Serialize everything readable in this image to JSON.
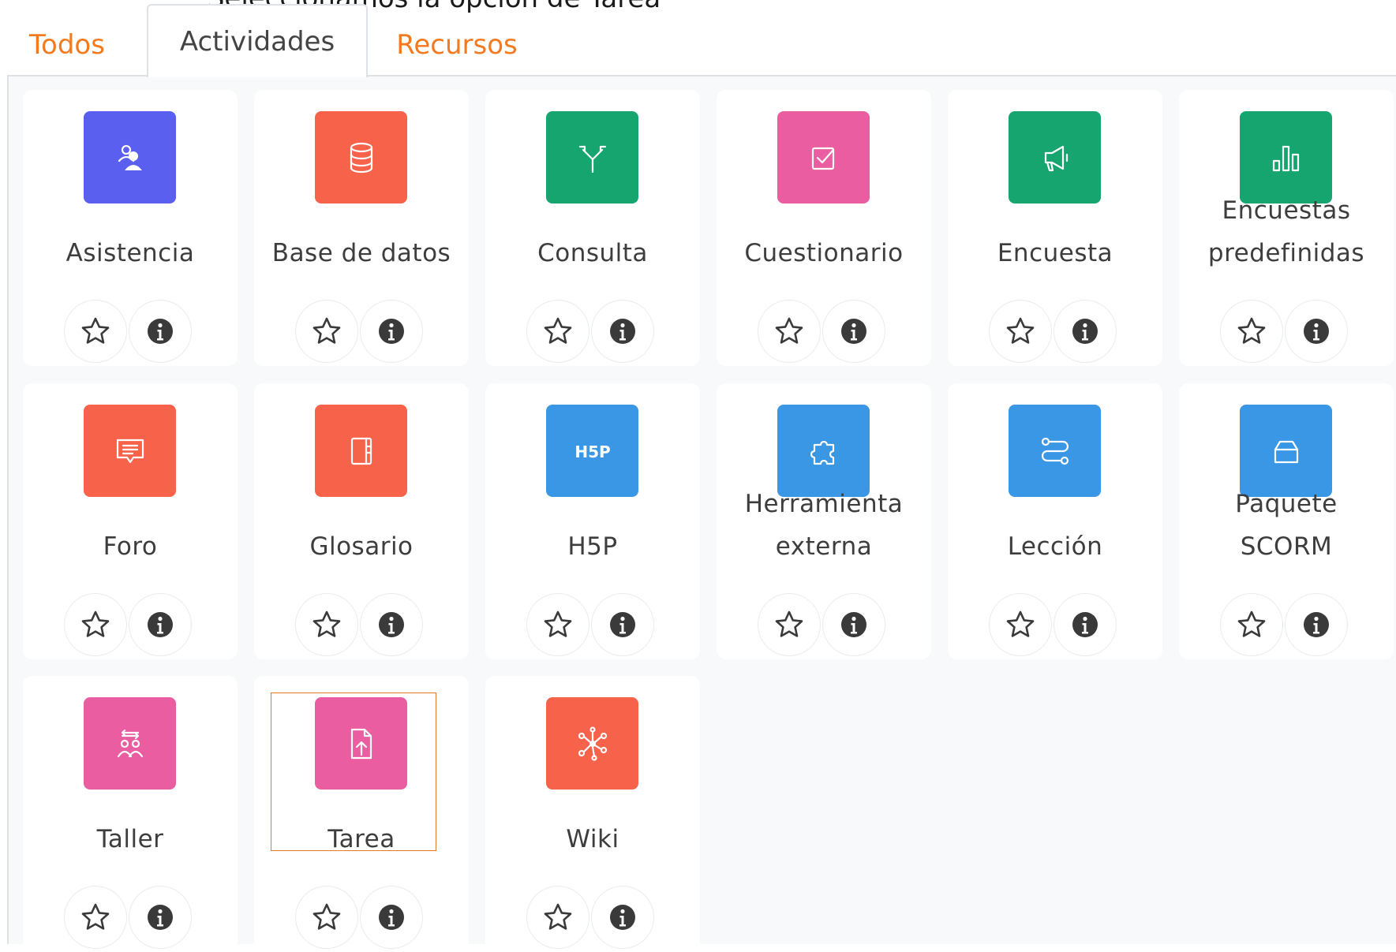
{
  "caption": "Seleccionamos la opción de Tarea",
  "tabs": [
    {
      "label": "Todos",
      "active": false
    },
    {
      "label": "Actividades",
      "active": true
    },
    {
      "label": "Recursos",
      "active": false
    }
  ],
  "activities": [
    {
      "label": "Asistencia",
      "icon": "attendance-icon",
      "color": "#5b5fef"
    },
    {
      "label": "Base de datos",
      "icon": "database-icon",
      "color": "#f7624b"
    },
    {
      "label": "Consulta",
      "icon": "choice-icon",
      "color": "#16a56e"
    },
    {
      "label": "Cuestionario",
      "icon": "quiz-icon",
      "color": "#ea5da0"
    },
    {
      "label": "Encuesta",
      "icon": "megaphone-icon",
      "color": "#16a56e"
    },
    {
      "label": "Encuestas predefinidas",
      "icon": "bar-chart-icon",
      "color": "#16a56e"
    },
    {
      "label": "Foro",
      "icon": "forum-icon",
      "color": "#f7624b"
    },
    {
      "label": "Glosario",
      "icon": "glossary-icon",
      "color": "#f7624b"
    },
    {
      "label": "H5P",
      "icon": "h5p-icon",
      "color": "#3a97e6"
    },
    {
      "label": "Herramienta externa",
      "icon": "puzzle-icon",
      "color": "#3a97e6"
    },
    {
      "label": "Lección",
      "icon": "lesson-icon",
      "color": "#3a97e6"
    },
    {
      "label": "Paquete SCORM",
      "icon": "package-icon",
      "color": "#3a97e6"
    },
    {
      "label": "Taller",
      "icon": "workshop-icon",
      "color": "#ea5da0"
    },
    {
      "label": "Tarea",
      "icon": "assignment-icon",
      "color": "#ea5da0"
    },
    {
      "label": "Wiki",
      "icon": "wiki-icon",
      "color": "#f7624b"
    }
  ],
  "buttons": {
    "star_icon": "star-icon",
    "info_icon": "info-icon"
  },
  "highlight_color": "#e37a2e"
}
